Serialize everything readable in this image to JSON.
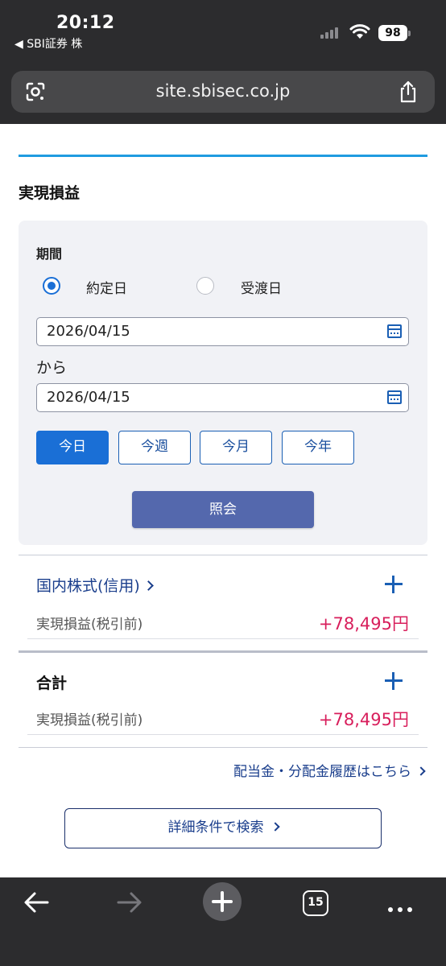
{
  "status_bar": {
    "time": "20:12",
    "back_app": "◀ SBI証券 株",
    "battery": "98"
  },
  "browser": {
    "url": "site.sbisec.co.jp",
    "tab_count": "15"
  },
  "page": {
    "section_title": "実現損益",
    "period": {
      "label": "期間",
      "options": [
        "約定日",
        "受渡日"
      ],
      "selected": "約定日",
      "from_date": "2026/04/15",
      "separator": "から",
      "to_date": "2026/04/15"
    },
    "range_buttons": [
      "今日",
      "今週",
      "今月",
      "今年"
    ],
    "active_range": "今日",
    "query_button": "照会",
    "rows": [
      {
        "title": "国内株式(信用)",
        "sub_label": "実現損益(税引前)",
        "amount": "+78,495円"
      },
      {
        "title": "合計",
        "sub_label": "実現損益(税引前)",
        "amount": "+78,495円"
      }
    ],
    "dividend_link": "配当金・分配金履歴はこちら",
    "detail_search_button": "詳細条件で検索"
  },
  "colors": {
    "accent_blue": "#1a6fd6",
    "query_button": "#5468ad",
    "profit": "#d81f5c",
    "link": "#1a3e8c"
  }
}
